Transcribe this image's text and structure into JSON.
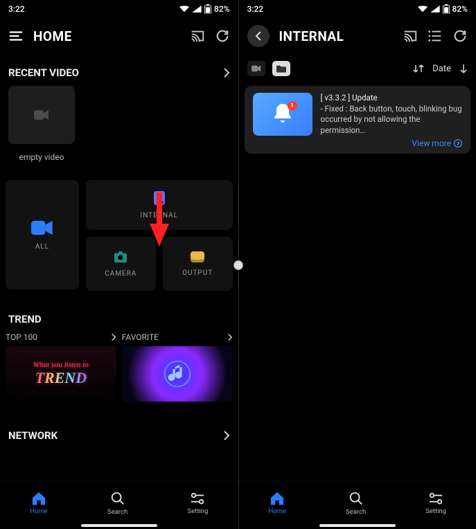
{
  "status": {
    "time": "3:22",
    "battery": "82%"
  },
  "left": {
    "header": {
      "title": "HOME"
    },
    "recent": {
      "title": "RECENT VIDEO",
      "empty_label": "empty video"
    },
    "tiles": {
      "all": "ALL",
      "internal": "INTERNAL",
      "camera": "CAMERA",
      "output": "OUTPUT"
    },
    "trend": {
      "title": "TREND",
      "top100": "TOP 100",
      "favorite": "FAVORITE",
      "img1_top": "What you listen to",
      "img1_main": "TREND"
    },
    "network": {
      "title": "NETWORK"
    }
  },
  "right": {
    "header": {
      "title": "INTERNAL"
    },
    "filter": {
      "sort": "Date"
    },
    "notice": {
      "badge": "1",
      "title": "[ v3.3.2 ] Update",
      "body": "- Fixed : Back button, touch, blinking bug occurred by not allowing the permission…",
      "more": "View more"
    }
  },
  "nav": {
    "home": "Home",
    "search": "Search",
    "setting": "Setting"
  }
}
